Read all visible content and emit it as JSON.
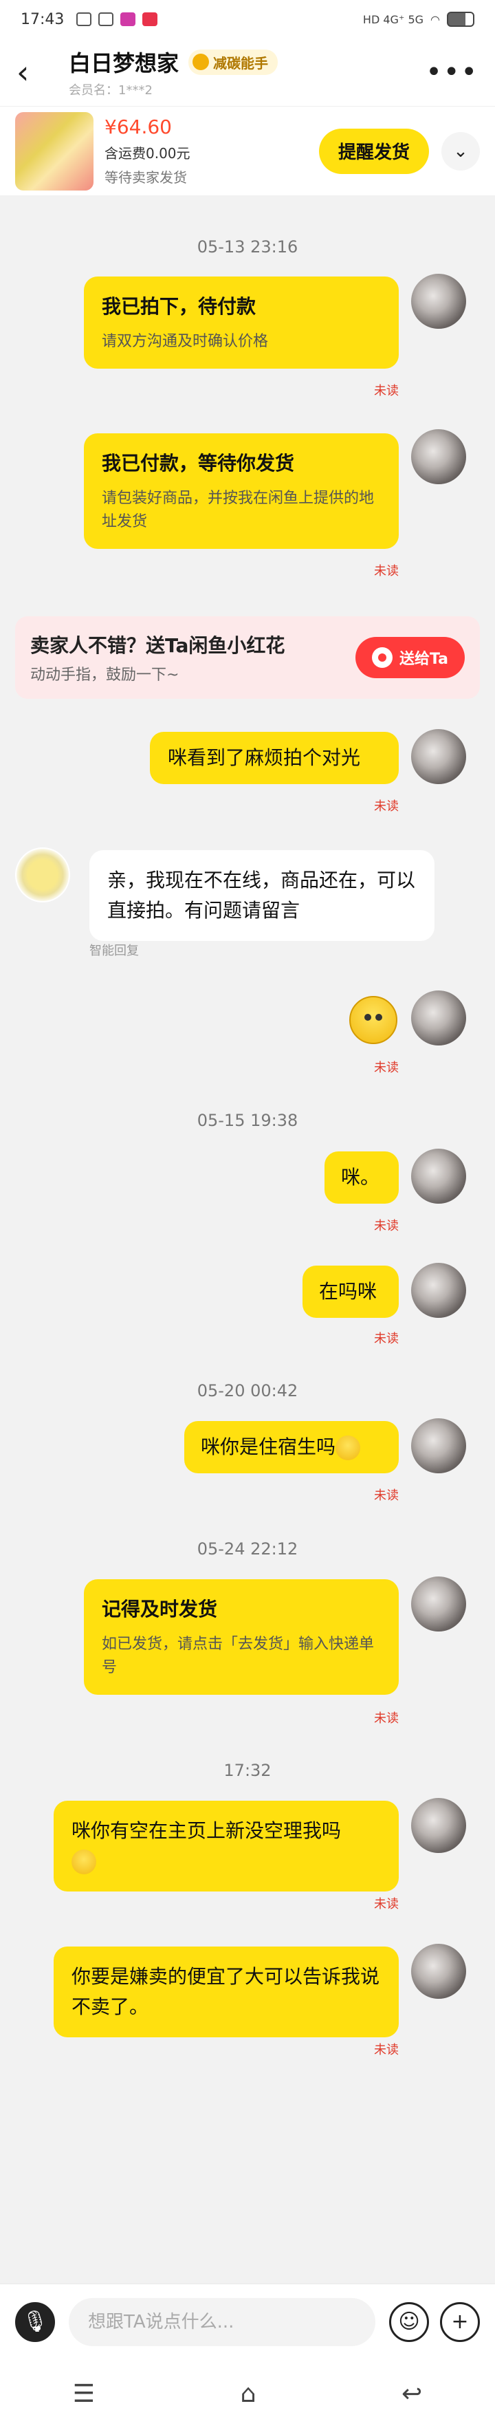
{
  "status_bar": {
    "time": "17:43",
    "right_text": "HD 4G⁺ 5G"
  },
  "header": {
    "back_icon": "chevron-left-icon",
    "name": "白日梦想家",
    "badge": "减碳能手",
    "sub": "会员名：1***2",
    "more_icon": "more-horizontal-icon"
  },
  "product": {
    "price": "¥64.60",
    "shipping": "含运费0.00元",
    "status": "等待卖家发货",
    "remind_label": "提醒发货",
    "expand_icon": "chevron-down-icon"
  },
  "messages": {
    "ts1": "05-13 23:16",
    "card1_title": "我已拍下，待付款",
    "card1_sub": "请双方沟通及时确认价格",
    "unread1": "未读",
    "card2_title": "我已付款，等待你发货",
    "card2_sub": "请包装好商品，并按我在闲鱼上提供的地址发货",
    "unread2": "未读",
    "promo_title": "卖家人不错？送Ta闲鱼小红花",
    "promo_sub": "动动手指，鼓励一下~",
    "promo_btn": "送给Ta",
    "msg3": "咪看到了麻烦拍个对光",
    "unread3": "未读",
    "reply": "亲，我现在不在线，商品还在，可以直接拍。有问题请留言",
    "smart_reply": "智能回复",
    "unread_emoji": "未读",
    "ts2": "05-15 19:38",
    "msg4": "咪。",
    "unread4": "未读",
    "msg5": "在吗咪",
    "unread5": "未读",
    "ts3": "05-20 00:42",
    "msg6": "咪你是住宿生吗",
    "unread6": "未读",
    "ts4": "05-24 22:12",
    "card3_title": "记得及时发货",
    "card3_sub": "如已发货，请点击「去发货」输入快递单号",
    "unread7": "未读",
    "ts5": "17:32",
    "msg7": "咪你有空在主页上新没空理我吗",
    "unread8": "未读",
    "msg8": "你要是嫌卖的便宜了大可以告诉我说不卖了。",
    "unread9": "未读"
  },
  "input": {
    "placeholder": "想跟TA说点什么...",
    "voice_icon": "microphone-icon",
    "emoji_icon": "emoji-icon",
    "plus_icon": "plus-icon"
  },
  "nav": {
    "menu_icon": "menu-icon",
    "home_icon": "home-icon",
    "back_icon": "back-icon"
  },
  "colors": {
    "accent": "#ffe00f",
    "price": "#ff4a2d",
    "unread": "#e03a2a",
    "promo_btn": "#ff3b3b"
  }
}
